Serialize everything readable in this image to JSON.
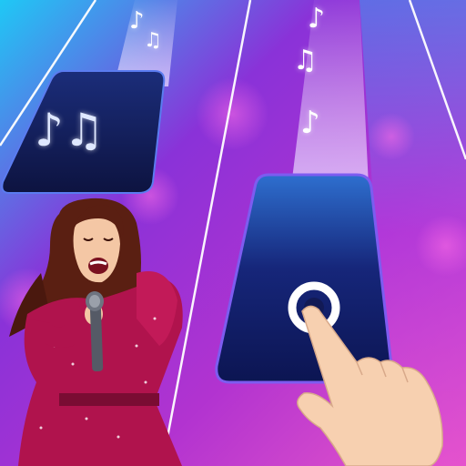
{
  "game": {
    "screen": "piano-tiles-gameplay",
    "lane_count": 4,
    "tiles": [
      {
        "id": "tile-upper-left",
        "symbol": "♪♫",
        "state": "falling"
      },
      {
        "id": "tile-active",
        "symbol": "",
        "state": "tap-target"
      }
    ],
    "floating_notes": [
      "♪",
      "♫",
      "♪",
      "♫",
      "♪"
    ],
    "tap_indicator": "tap-ring-icon",
    "hand_icon": "pointing-hand-icon",
    "character": "singer-with-microphone"
  },
  "colors": {
    "bg_top_left": "#1fc8f5",
    "bg_mid": "#9b2fd6",
    "bg_bottom": "#e84fc4",
    "tile_dark": "#0f1a4a",
    "tile_glow": "#3a7bd5",
    "lane_line": "#ffffff",
    "outfit": "#b0134d"
  }
}
